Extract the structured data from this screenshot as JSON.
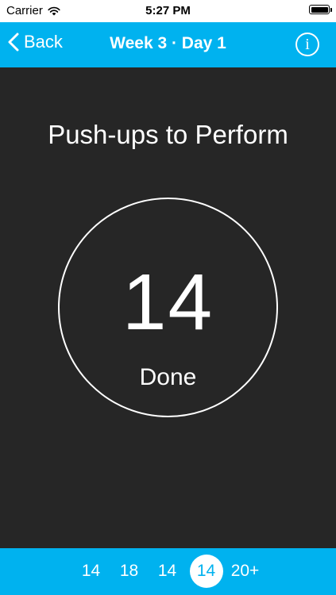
{
  "status_bar": {
    "carrier": "Carrier",
    "time": "5:27 PM",
    "battery_level_percent": 100
  },
  "nav": {
    "back_label": "Back",
    "title": "Week 3 · Day 1",
    "info_label": "i"
  },
  "main": {
    "headline": "Push-ups to Perform",
    "rep_count": "14",
    "done_label": "Done"
  },
  "sets": {
    "items": [
      "14",
      "18",
      "14",
      "14",
      "20+"
    ],
    "current_index": 3
  },
  "colors": {
    "accent": "#00b2ef",
    "background": "#262626",
    "text": "#ffffff"
  }
}
